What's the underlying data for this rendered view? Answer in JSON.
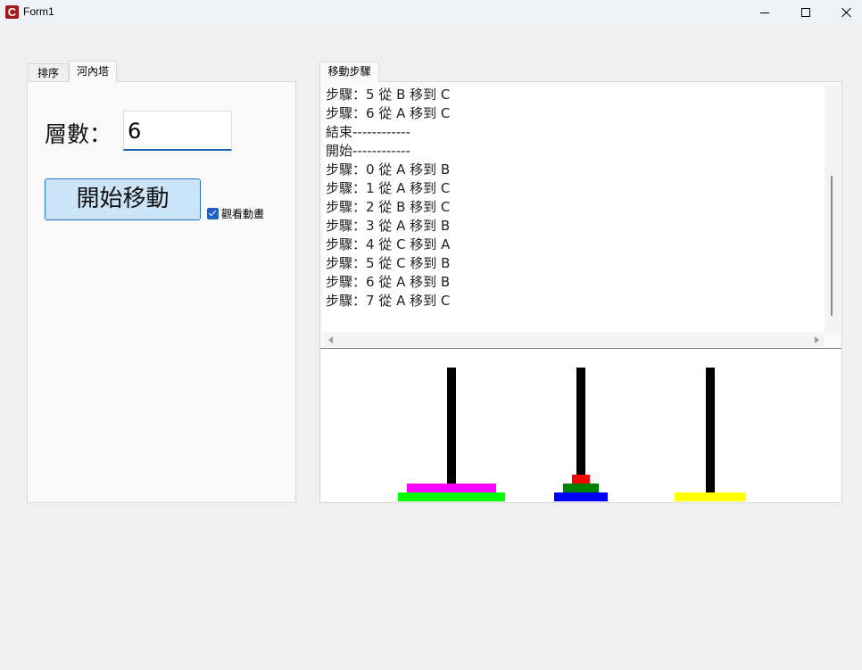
{
  "window": {
    "title": "Form1",
    "icon": "app-c-icon",
    "icon_letter": "C",
    "controls": [
      "minimize-icon",
      "maximize-icon",
      "close-icon"
    ]
  },
  "left_tabs": {
    "tab_sort": "排序",
    "tab_hanoi": "河內塔",
    "active": "河內塔"
  },
  "hanoi_panel": {
    "layers_label": "層數：",
    "layers_value": "6",
    "start_button": "開始移動",
    "watch_animation_label": "觀看動畫",
    "watch_animation_checked": true
  },
  "right_tabs": {
    "tab_steps": "移動步驟"
  },
  "log_lines": [
    "步驟：5 從 B 移到 C",
    "步驟：6 從 A 移到 C",
    "結束------------",
    "開始------------",
    "步驟：0 從 A 移到 B",
    "步驟：1 從 A 移到 C",
    "步驟：2 從 B 移到 C",
    "步驟：3 從 A 移到 B",
    "步驟：4 從 C 移到 A",
    "步驟：5 從 C 移到 B",
    "步驟：6 從 A 移到 B",
    "步驟：7 從 A 移到 C"
  ],
  "hanoi_visual": {
    "peg_color": "#000000",
    "pegs": [
      {
        "disks": [
          {
            "size": 6,
            "color": "#00ff00"
          },
          {
            "size": 5,
            "color": "#ff00ff"
          }
        ]
      },
      {
        "disks": [
          {
            "size": 3,
            "color": "#0000ff"
          },
          {
            "size": 2,
            "color": "#008000"
          },
          {
            "size": 1,
            "color": "#ff0000"
          }
        ]
      },
      {
        "disks": [
          {
            "size": 4,
            "color": "#ffff00"
          }
        ]
      }
    ]
  }
}
